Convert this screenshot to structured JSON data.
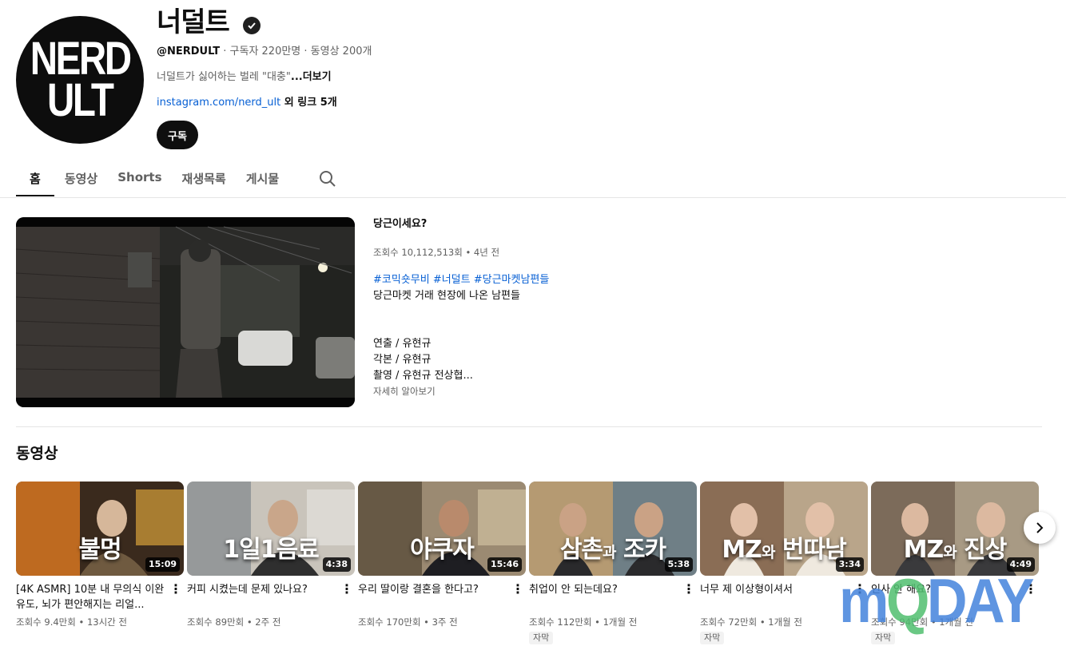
{
  "channel": {
    "name": "너덜트",
    "handle": "@NERDULT",
    "stats": " · 구독자 220만명 · 동영상 200개",
    "description": "너덜트가 싫어하는 벌레 \"대충\"",
    "description_more": "...더보기",
    "link_url": "instagram.com/nerd_ult",
    "link_extra": " 외 링크 5개",
    "subscribe_label": "구독",
    "avatar_text": [
      "NERD",
      "ULT"
    ]
  },
  "tabs": [
    {
      "label": "홈",
      "active": true
    },
    {
      "label": "동영상"
    },
    {
      "label": "Shorts"
    },
    {
      "label": "재생목록"
    },
    {
      "label": "게시물"
    }
  ],
  "featured": {
    "title": "당근이세요?",
    "stats": "조회수 10,112,513회 • 4년 전",
    "hashtags": "#코믹숏무비 #너덜트 #당근마켓남편들",
    "subtitle": "당근마켓 거래 현장에 나온 남편들",
    "credits": [
      "연출 / 유현규",
      "각본 / 유현규",
      "촬영 / 유현규 전상협..."
    ],
    "more_label": "자세히 알아보기"
  },
  "shelf": {
    "title": "동영상",
    "videos": [
      {
        "overlay": "불멍",
        "overlay_small": "",
        "overlay_rest": "",
        "duration": "15:09",
        "title": "[4K ASMR] 10분 내 무의식 이완 유도, 뇌가 편안해지는 리얼...",
        "stats": "조회수 9.4만회 • 13시간 전",
        "badge": "",
        "scheme": "fire"
      },
      {
        "overlay": "1일1음료",
        "overlay_small": "",
        "overlay_rest": "",
        "duration": "4:38",
        "title": "커피 시켰는데 문제 있나요?",
        "stats": "조회수 89만회 • 2주 전",
        "badge": "",
        "scheme": "office"
      },
      {
        "overlay": "야쿠자",
        "overlay_small": "",
        "overlay_rest": "",
        "duration": "15:46",
        "title": "우리 딸이랑 결혼을 한다고?",
        "stats": "조회수 170만회 • 3주 전",
        "badge": "",
        "scheme": "room"
      },
      {
        "overlay": "삼촌",
        "overlay_small": "과",
        "overlay_rest": " 조카",
        "duration": "5:38",
        "title": "취업이 안 되는데요?",
        "stats": "조회수 112만회 • 1개월 전",
        "badge": "자막",
        "scheme": "duo"
      },
      {
        "overlay": "MZ",
        "overlay_small": "와",
        "overlay_rest": " 번따남",
        "duration": "3:34",
        "title": "너무 제 이상형이셔서",
        "stats": "조회수 72만회 • 1개월 전",
        "badge": "자막",
        "scheme": "cafe"
      },
      {
        "overlay": "MZ",
        "overlay_small": "와",
        "overlay_rest": " 진상",
        "duration": "4:49",
        "title": "인사 안 해요?",
        "stats": "조회수 94만회 • 1개월 전",
        "badge": "자막",
        "scheme": "cafe2"
      }
    ]
  },
  "watermark": {
    "part1": "m",
    "part2": "Q",
    "part3": "DAY"
  },
  "colors": {
    "link": "#065fd4",
    "text": "#0f0f0f",
    "secondary": "#606060",
    "button": "#0f0f0f"
  },
  "icons": [
    "verified-icon",
    "search-icon",
    "more-vert-icon",
    "chevron-right-icon"
  ]
}
